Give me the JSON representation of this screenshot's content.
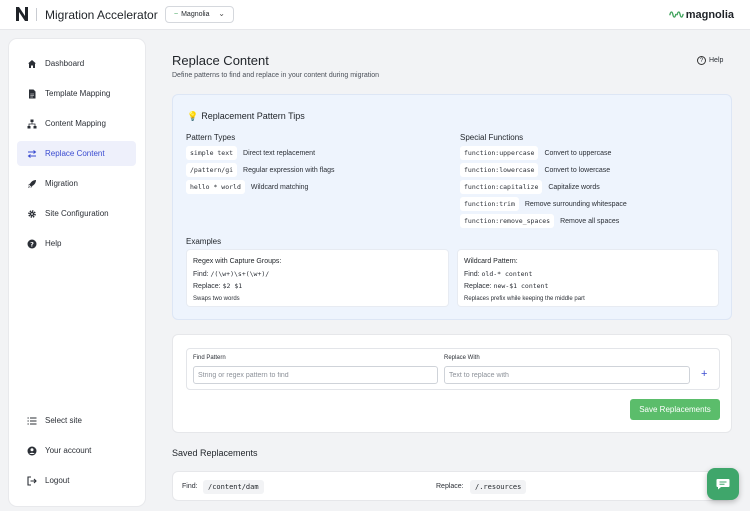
{
  "header": {
    "app_title": "Migration Accelerator",
    "site_selector": "Magnolia",
    "brand": "magnolia"
  },
  "sidebar": {
    "items": [
      {
        "label": "Dashboard",
        "icon": "home-icon"
      },
      {
        "label": "Template Mapping",
        "icon": "document-icon"
      },
      {
        "label": "Content Mapping",
        "icon": "sitemap-icon"
      },
      {
        "label": "Replace Content",
        "icon": "swap-arrows-icon",
        "active": true
      },
      {
        "label": "Migration",
        "icon": "rocket-icon"
      },
      {
        "label": "Site Configuration",
        "icon": "gear-icon"
      },
      {
        "label": "Help",
        "icon": "question-icon"
      }
    ],
    "bottom_items": [
      {
        "label": "Select site",
        "icon": "list-icon"
      },
      {
        "label": "Your account",
        "icon": "user-icon"
      },
      {
        "label": "Logout",
        "icon": "logout-icon"
      }
    ]
  },
  "page": {
    "title": "Replace Content",
    "subtitle": "Define patterns to find and replace in your content during migration",
    "help": "Help"
  },
  "tips": {
    "title": "Replacement Pattern Tips",
    "pattern_types_heading": "Pattern Types",
    "pattern_types": [
      {
        "code": "simple text",
        "desc": "Direct text replacement"
      },
      {
        "code": "/pattern/gi",
        "desc": "Regular expression with flags"
      },
      {
        "code": "hello * world",
        "desc": "Wildcard matching"
      }
    ],
    "special_functions_heading": "Special Functions",
    "special_functions": [
      {
        "code": "function:uppercase",
        "desc": "Convert to uppercase"
      },
      {
        "code": "function:lowercase",
        "desc": "Convert to lowercase"
      },
      {
        "code": "function:capitalize",
        "desc": "Capitalize words"
      },
      {
        "code": "function:trim",
        "desc": "Remove surrounding whitespace"
      },
      {
        "code": "function:remove_spaces",
        "desc": "Remove all spaces"
      }
    ],
    "examples_heading": "Examples",
    "examples": [
      {
        "title": "Regex with Capture Groups:",
        "find_label": "Find:",
        "find": "/(\\w+)\\s+(\\w+)/",
        "replace_label": "Replace:",
        "replace": "$2 $1",
        "note": "Swaps two words"
      },
      {
        "title": "Wildcard Pattern:",
        "find_label": "Find:",
        "find": "old-* content",
        "replace_label": "Replace:",
        "replace": "new-$1 content",
        "note": "Replaces prefix while keeping the middle part"
      }
    ]
  },
  "form": {
    "find_label": "Find Pattern",
    "find_placeholder": "String or regex pattern to find",
    "replace_label": "Replace With",
    "replace_placeholder": "Text to replace with",
    "add_symbol": "+",
    "save_label": "Save Replacements"
  },
  "saved": {
    "title": "Saved Replacements",
    "rows": [
      {
        "find_label": "Find:",
        "find": "/content/dam",
        "replace_label": "Replace:",
        "replace": "/.resources"
      }
    ]
  },
  "colors": {
    "accent": "#3a4bd0",
    "brand_green": "#41a35d",
    "button_green": "#5bbd6b"
  }
}
